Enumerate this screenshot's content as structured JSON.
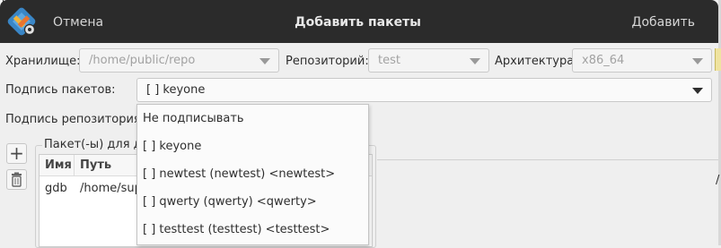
{
  "window": {
    "title": "Добавить пакеты",
    "cancel_label": "Отмена",
    "add_label": "Добавить"
  },
  "form": {
    "storage": {
      "label": "Хранилище:",
      "value": "/home/public/repo"
    },
    "repository": {
      "label": "Репозиторий:",
      "value": "test"
    },
    "architecture": {
      "label": "Архитектура:",
      "value": "x86_64"
    },
    "package_signature": {
      "label": "Подпись пакетов:",
      "value": "[  ] keyone"
    },
    "repo_signature": {
      "label": "Подпись репозитория:"
    }
  },
  "dropdown": {
    "options": [
      "Не подписывать",
      "[  ] keyone",
      "[  ] newtest (newtest) <newtest>",
      "[  ] qwerty (qwerty) <qwerty>",
      "[  ] testtest (testtest) <testtest>"
    ]
  },
  "packages": {
    "group_label": "Пакет(-ы) для до",
    "columns": [
      "Имя",
      "Путь"
    ],
    "rows": [
      {
        "name": "gdb",
        "path": "/home/sup"
      }
    ],
    "add_icon": "+",
    "right_edge_char": "/"
  },
  "colors": {
    "header_bg": "#2b2b2b",
    "window_bg": "#efefef",
    "popup_bg": "#fbfbfb"
  },
  "icons": [
    "app-logo-icon",
    "plus-icon",
    "trash-icon",
    "dropdown-arrow-icon"
  ]
}
